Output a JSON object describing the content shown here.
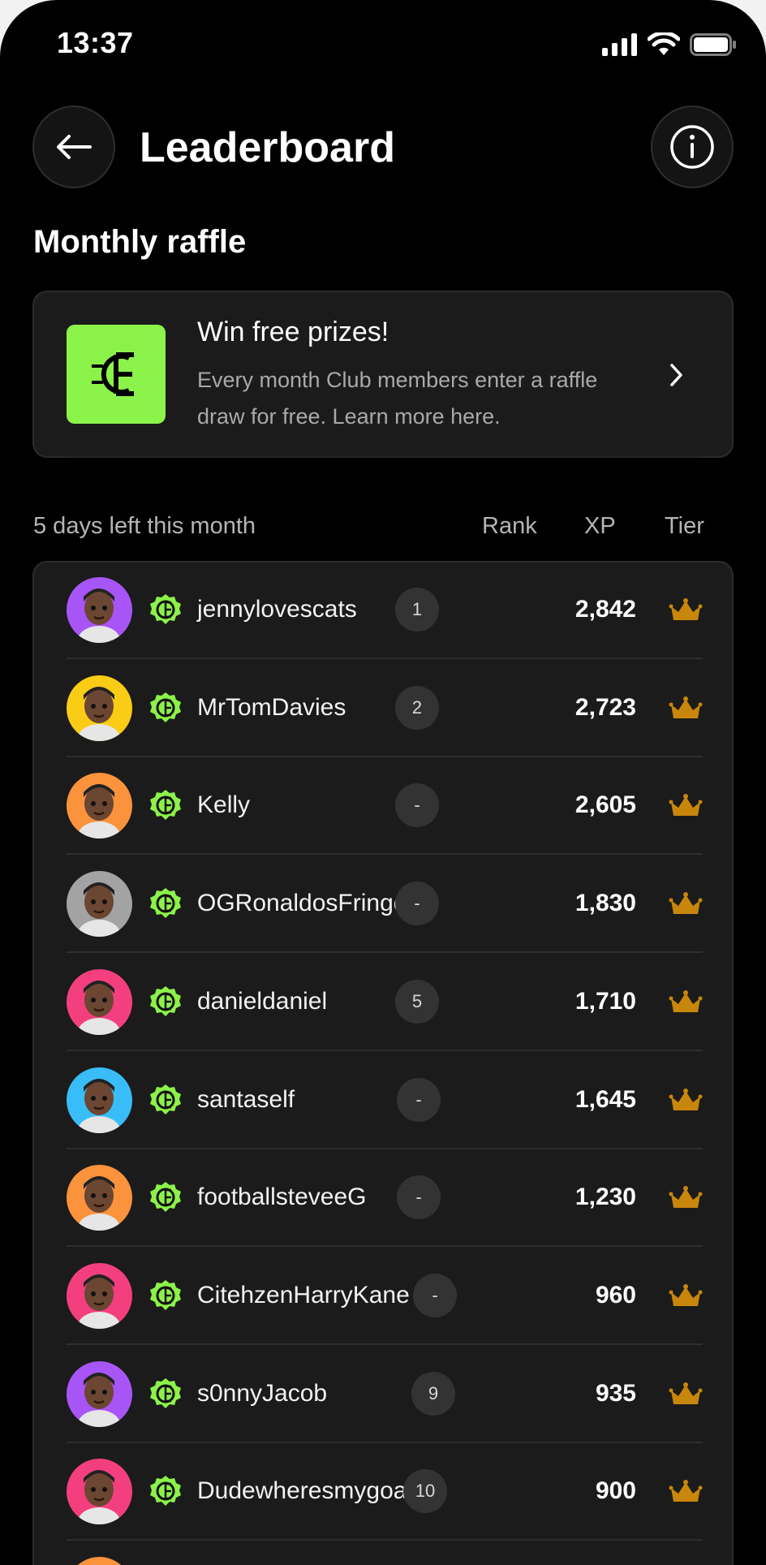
{
  "status_bar": {
    "time": "13:37"
  },
  "header": {
    "title": "Leaderboard"
  },
  "section_title": "Monthly raffle",
  "promo": {
    "title": "Win free prizes!",
    "description": "Every month Club members enter a raffle draw for free. Learn more here."
  },
  "table": {
    "days_left": "5 days left this month",
    "columns": {
      "rank": "Rank",
      "xp": "XP",
      "tier": "Tier"
    },
    "rows": [
      {
        "username": "jennylovescats",
        "rank": "1",
        "xp": "2,842",
        "avatar_color": "#a855f7"
      },
      {
        "username": "MrTomDavies",
        "rank": "2",
        "xp": "2,723",
        "avatar_color": "#facc15"
      },
      {
        "username": "Kelly",
        "rank": "-",
        "xp": "2,605",
        "avatar_color": "#fb923c"
      },
      {
        "username": "OGRonaldosFringe",
        "rank": "-",
        "xp": "1,830",
        "avatar_color": "#a3a3a3"
      },
      {
        "username": "danieldaniel",
        "rank": "5",
        "xp": "1,710",
        "avatar_color": "#f43f7f"
      },
      {
        "username": "santaself",
        "rank": "-",
        "xp": "1,645",
        "avatar_color": "#38bdf8"
      },
      {
        "username": "footballsteveeG",
        "rank": "-",
        "xp": "1,230",
        "avatar_color": "#fb923c"
      },
      {
        "username": "CitehzenHarryKane",
        "rank": "-",
        "xp": "960",
        "avatar_color": "#f43f7f"
      },
      {
        "username": "s0nnyJacob",
        "rank": "9",
        "xp": "935",
        "avatar_color": "#a855f7"
      },
      {
        "username": "Dudewheresmygoalk...",
        "rank": "10",
        "xp": "900",
        "avatar_color": "#f43f7f"
      }
    ]
  },
  "colors": {
    "brand_green": "#8bf24a",
    "tier_gold": "#c8860a"
  },
  "icons": {
    "back": "arrow-left-icon",
    "info": "info-icon",
    "promo": "club-logo-icon",
    "chevron": "chevron-right-icon",
    "badge": "club-badge-icon",
    "tier": "crown-icon"
  }
}
